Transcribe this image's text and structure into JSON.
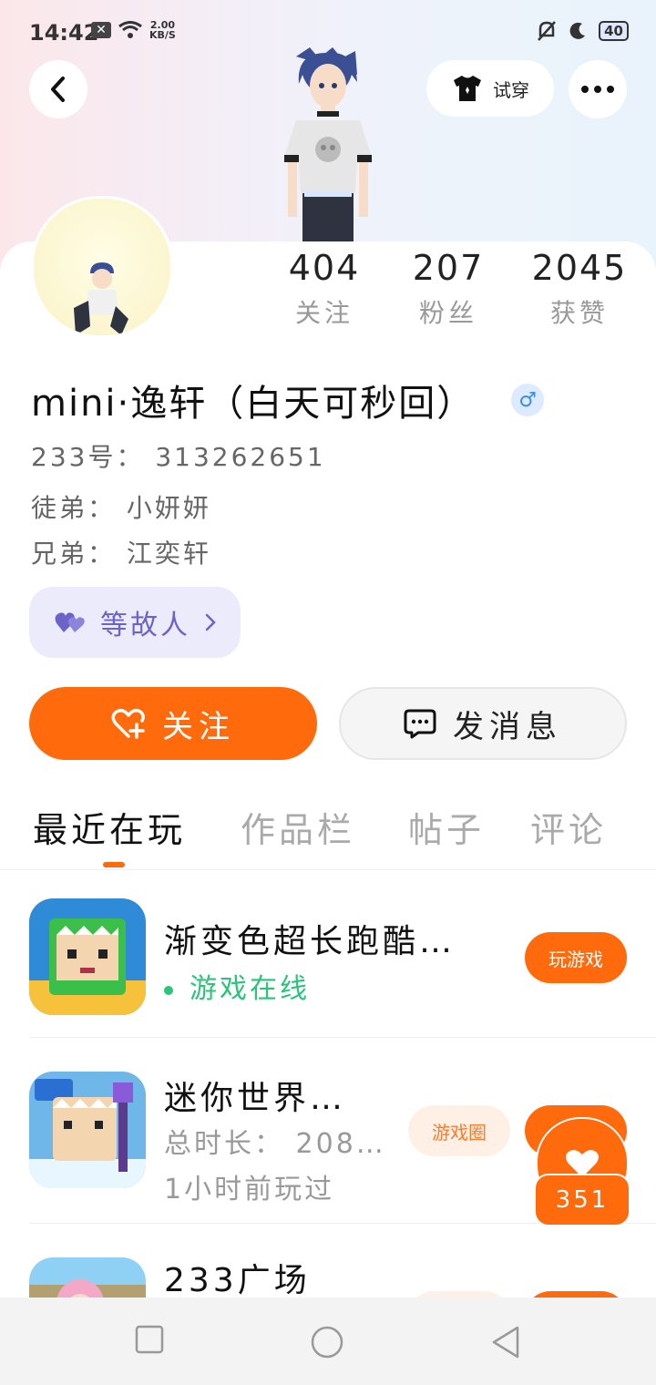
{
  "status_bar": {
    "time": "14:42",
    "speed_value": "2.00",
    "speed_unit": "KB/S",
    "battery": "40"
  },
  "header": {
    "try_on_label": "试穿"
  },
  "stats": [
    {
      "value": "404",
      "label": "关注"
    },
    {
      "value": "207",
      "label": "粉丝"
    },
    {
      "value": "2045",
      "label": "获赞"
    }
  ],
  "profile": {
    "username": "mini·逸轩（白天可秒回）",
    "gender_symbol": "♂",
    "id_line": "233号： 313262651",
    "apprentice_line": "徒弟： 小妍妍",
    "sibling_line": "兄弟： 江奕轩",
    "tag_label": "等故人"
  },
  "actions": {
    "follow_label": "关注",
    "message_label": "发消息"
  },
  "tabs": [
    "最近在玩",
    "作品栏",
    "帖子",
    "评论"
  ],
  "games": [
    {
      "title": "渐变色超长跑酷…",
      "status": "游戏在线",
      "play_label": "玩游戏"
    },
    {
      "title": "迷你世界…",
      "duration": "总时长： 208…",
      "last_played": "1小时前玩过",
      "circle_label": "游戏圈"
    },
    {
      "title": "233广场"
    }
  ],
  "likes": {
    "count": "351"
  },
  "colors": {
    "accent": "#ff6a0d",
    "online": "#2cc37a",
    "tag": "#6c63c9"
  }
}
